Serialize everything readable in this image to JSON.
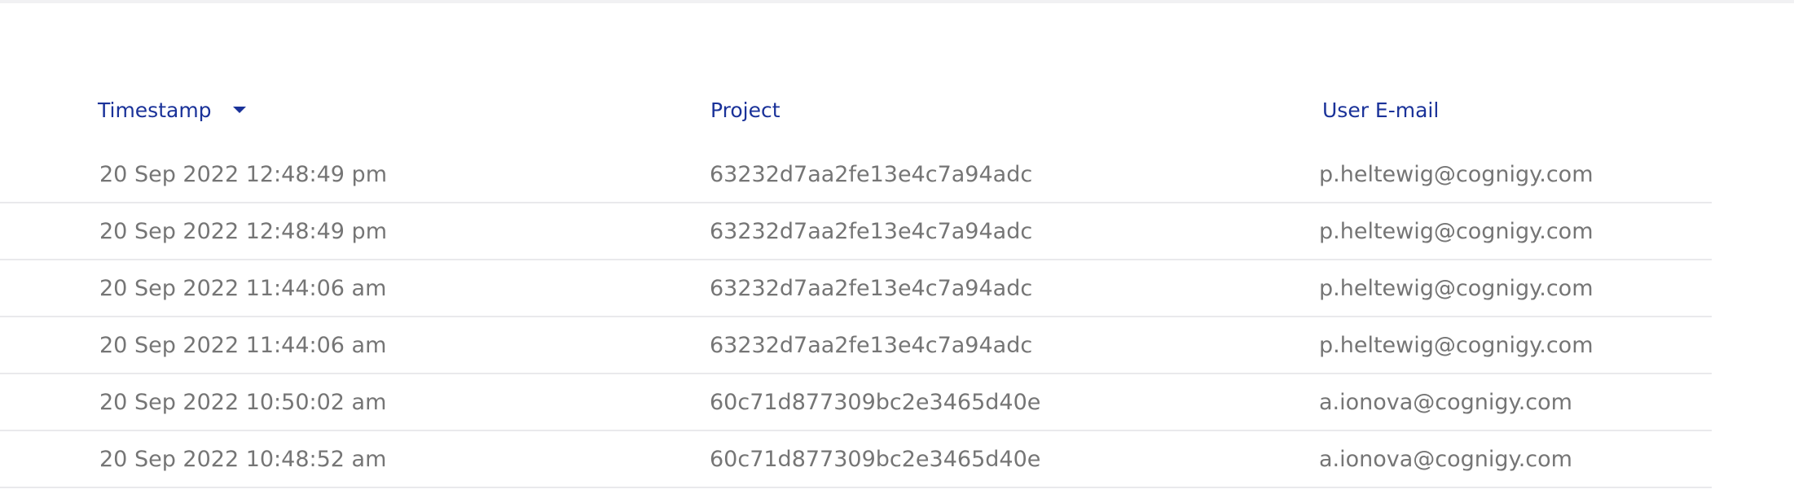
{
  "table": {
    "columns": [
      {
        "label": "Timestamp",
        "sorted": "descending"
      },
      {
        "label": "Project"
      },
      {
        "label": "User E-mail"
      }
    ],
    "rows": [
      {
        "timestamp": "20 Sep 2022 12:48:49 pm",
        "project": "63232d7aa2fe13e4c7a94adc",
        "email": "p.heltewig@cognigy.com"
      },
      {
        "timestamp": "20 Sep 2022 12:48:49 pm",
        "project": "63232d7aa2fe13e4c7a94adc",
        "email": "p.heltewig@cognigy.com"
      },
      {
        "timestamp": "20 Sep 2022 11:44:06 am",
        "project": "63232d7aa2fe13e4c7a94adc",
        "email": "p.heltewig@cognigy.com"
      },
      {
        "timestamp": "20 Sep 2022 11:44:06 am",
        "project": "63232d7aa2fe13e4c7a94adc",
        "email": "p.heltewig@cognigy.com"
      },
      {
        "timestamp": "20 Sep 2022 10:50:02 am",
        "project": "60c71d877309bc2e3465d40e",
        "email": "a.ionova@cognigy.com"
      },
      {
        "timestamp": "20 Sep 2022 10:48:52 am",
        "project": "60c71d877309bc2e3465d40e",
        "email": "a.ionova@cognigy.com"
      }
    ]
  },
  "colors": {
    "header_text": "#1a3299",
    "cell_text": "#757575",
    "row_divider": "#e9e9ec"
  }
}
